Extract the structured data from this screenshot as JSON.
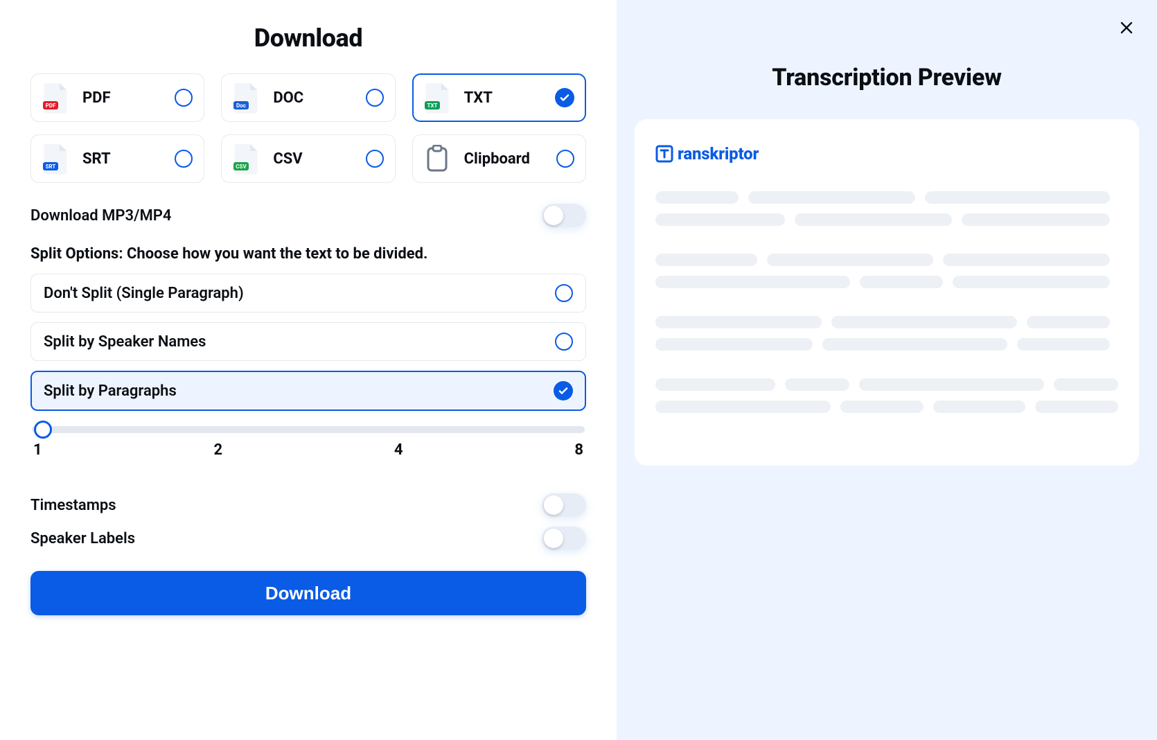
{
  "title": "Download",
  "formats": [
    {
      "id": "pdf",
      "label": "PDF",
      "badge": "PDF",
      "badgeColor": "#e11d2a",
      "selected": false
    },
    {
      "id": "doc",
      "label": "DOC",
      "badge": "Doc",
      "badgeColor": "#1a5fd6",
      "selected": false
    },
    {
      "id": "txt",
      "label": "TXT",
      "badge": "TXT",
      "badgeColor": "#0f9d58",
      "selected": true
    },
    {
      "id": "srt",
      "label": "SRT",
      "badge": "SRT",
      "badgeColor": "#0a5be5",
      "selected": false
    },
    {
      "id": "csv",
      "label": "CSV",
      "badge": "CSV",
      "badgeColor": "#1aa34a",
      "selected": false
    },
    {
      "id": "clip",
      "label": "Clipboard",
      "badge": "",
      "badgeColor": "",
      "selected": false,
      "clipboard": true
    }
  ],
  "downloadMedia": {
    "label": "Download MP3/MP4",
    "value": false
  },
  "splitHeading": "Split Options: Choose how you want the text to be divided.",
  "splitOptions": [
    {
      "label": "Don't Split (Single Paragraph)",
      "selected": false
    },
    {
      "label": "Split by Speaker Names",
      "selected": false
    },
    {
      "label": "Split by Paragraphs",
      "selected": true
    }
  ],
  "slider": {
    "ticks": [
      "1",
      "2",
      "4",
      "8"
    ],
    "value": 1
  },
  "toggles": {
    "timestamps": {
      "label": "Timestamps",
      "value": false
    },
    "speakerLabels": {
      "label": "Speaker Labels",
      "value": false
    }
  },
  "downloadButton": "Download",
  "preview": {
    "title": "Transcription Preview",
    "brand": "ranskriptor"
  }
}
